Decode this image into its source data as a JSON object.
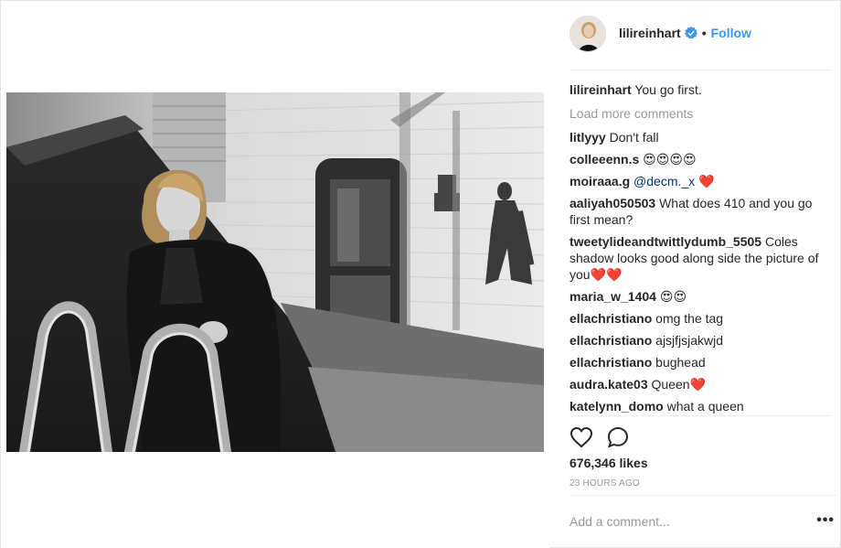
{
  "post": {
    "author": "lilireinhart",
    "follow_label": "Follow",
    "separator": "•",
    "caption_user": "lilireinhart",
    "caption_text": "You go first.",
    "load_more_label": "Load more comments",
    "likes": "676,346 likes",
    "timestamp": "23 HOURS AGO",
    "add_comment_placeholder": "Add a comment...",
    "more_options": "•••"
  },
  "comments": [
    {
      "user": "litlyyy",
      "text": "Don't fall"
    },
    {
      "user": "colleeenn.s",
      "text": "😍😍😍😍"
    },
    {
      "user": "moiraaa.g",
      "mention": "@decm._x",
      "text": "❤️"
    },
    {
      "user": "aaliyah050503",
      "text": "What does 410 and you go first mean?"
    },
    {
      "user": "tweetylideandtwittlydumb_5505",
      "text": "Coles shadow looks good along side the picture of you❤️❤️"
    },
    {
      "user": "maria_w_1404",
      "text": "😍😍"
    },
    {
      "user": "ellachristiano",
      "text": "omg the tag"
    },
    {
      "user": "ellachristiano",
      "text": "ajsjfjsjakwjd"
    },
    {
      "user": "ellachristiano",
      "text": "bughead"
    },
    {
      "user": "audra.kate03",
      "text": "Queen❤️"
    },
    {
      "user": "katelynn_domo",
      "text": "what a queen"
    }
  ],
  "colors": {
    "link_blue": "#3897f0",
    "verified_blue": "#3897f0",
    "muted_gray": "#999999",
    "border": "#efefef"
  },
  "icons": {
    "like": "heart-outline-icon",
    "comment": "speech-bubble-icon",
    "verified": "verified-badge-icon"
  }
}
